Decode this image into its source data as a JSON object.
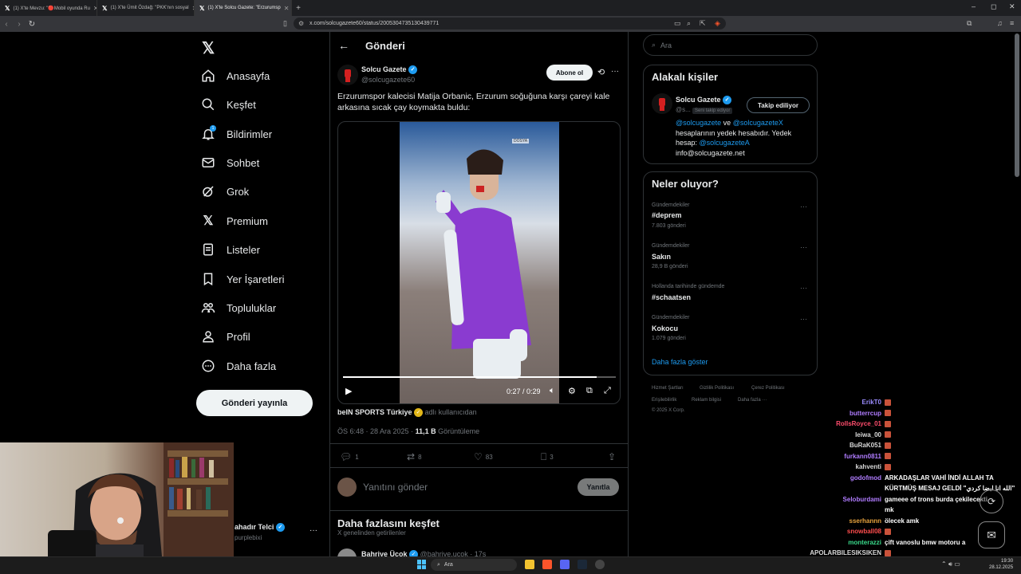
{
  "browser": {
    "tabs": [
      {
        "label": "(1) X'te Mevzu: \"🔴Mobil oyunda Ru",
        "active": false
      },
      {
        "label": "(1) X'te Ümit Özdağ: \"PKK'nın sosyal",
        "active": false
      },
      {
        "label": "(1) X'te Solcu Gazete: \"Erzurumsp",
        "active": true
      }
    ],
    "url": "x.com/solcugazete60/status/2005304735130439771"
  },
  "sidebar": {
    "items": [
      {
        "label": "Anasayfa",
        "icon": "home-icon"
      },
      {
        "label": "Keşfet",
        "icon": "search-icon"
      },
      {
        "label": "Bildirimler",
        "icon": "bell-icon"
      },
      {
        "label": "Sohbet",
        "icon": "mail-icon"
      },
      {
        "label": "Grok",
        "icon": "grok-icon"
      },
      {
        "label": "Premium",
        "icon": "x-logo-icon"
      },
      {
        "label": "Listeler",
        "icon": "list-icon"
      },
      {
        "label": "Yer İşaretleri",
        "icon": "bookmark-icon"
      },
      {
        "label": "Topluluklar",
        "icon": "people-icon"
      },
      {
        "label": "Profil",
        "icon": "profile-icon"
      },
      {
        "label": "Daha fazla",
        "icon": "more-circle-icon"
      }
    ],
    "notification_count": "1",
    "post_button": "Gönderi yayınla",
    "account_name": "ahadır Telci",
    "account_handle": "purplebixi"
  },
  "main": {
    "header_title": "Gönderi",
    "author_name": "Solcu Gazete",
    "author_handle": "@solcugazete60",
    "subscribe_label": "Abone ol",
    "post_text": "Erzurumspor kalecisi Matija Orbanic, Erzurum soğuğuna karşı çareyi kale arkasına sıcak çay koymakta buldu:",
    "video_time": "0:27 / 0:29",
    "video_progress": 0.93,
    "video_watermark": "DOSYA",
    "source_name": "beIN SPORTS Türkiye",
    "source_suffix": "adlı kullanıcıdan",
    "timestamp": "ÖS 6:48 · 28 Ara 2025 ·",
    "views_count": "11,1 B",
    "views_label": "Görüntüleme",
    "replies": "1",
    "reposts": "8",
    "likes": "83",
    "bookmarks": "3",
    "reply_placeholder": "Yanıtını gönder",
    "reply_button": "Yanıtla",
    "discover_title": "Daha fazlasını keşfet",
    "discover_subtitle": "X genelinden getirilenler",
    "next_author": "Bahriye Üçok",
    "next_handle": "@bahriye.ucok · 17s"
  },
  "right": {
    "search_placeholder": "Ara",
    "related_title": "Alakalı kişiler",
    "related_name": "Solcu Gazete",
    "related_handle": "@s...",
    "follows_you": "Seni takip ediyor",
    "following_button": "Takip ediliyor",
    "bio_mention1": "@solcugazete",
    "bio_and": " ve ",
    "bio_mention2": "@solcugazeteX",
    "bio_text1": "hesaplarının yedek hesabıdır. Yedek",
    "bio_text2": "hesap: ",
    "bio_mention3": "@solcugazeteA",
    "bio_email": "info@solcugazete.net",
    "trends_title": "Neler oluyor?",
    "trends": [
      {
        "category": "Gündemdekiler",
        "name": "#deprem",
        "count": "7.803 gönderi"
      },
      {
        "category": "Gündemdekiler",
        "name": "Sakın",
        "count": "28,9 B gönderi"
      },
      {
        "category": "Hollanda tarihinde gündemde",
        "name": "#schaatsen",
        "count": ""
      },
      {
        "category": "Gündemdekiler",
        "name": "Kokocu",
        "count": "1.079 gönderi"
      }
    ],
    "show_more": "Daha fazla göster",
    "footer": [
      "Hizmet Şartları",
      "Gizlilik Politikası",
      "Çerez Politikası",
      "Erişilebilirlik",
      "Reklam bilgisi",
      "Daha fazla ···"
    ],
    "copyright": "© 2025 X Corp."
  },
  "chat": [
    {
      "user": "ErikT0",
      "color": "#9b8cff",
      "msg": ""
    },
    {
      "user": "butterrcup",
      "color": "#b07cff",
      "msg": ""
    },
    {
      "user": "RollsRoyce_01",
      "color": "#ff4d6d",
      "msg": ""
    },
    {
      "user": "leiwa_00",
      "color": "#d9d9d9",
      "msg": ""
    },
    {
      "user": "BuRaK051",
      "color": "#d9d9d9",
      "msg": ""
    },
    {
      "user": "furkann0811",
      "color": "#b07cff",
      "msg": ""
    },
    {
      "user": "kahventi",
      "color": "#d9d9d9",
      "msg": ""
    },
    {
      "user": "godofmod",
      "color": "#b07cff",
      "msg": "ARKADAŞLAR VAHİ İNDİ ALLAH TA"
    },
    {
      "user": "",
      "color": "#b07cff",
      "msg": "KÜRTMÜŞ MESAJ GELDİ \"الله انا ايضا كردي\""
    },
    {
      "user": "Seloburdami",
      "color": "#b07cff",
      "msg": "gameee of trons burda çekilecekti"
    },
    {
      "user": "",
      "color": "#b07cff",
      "msg": "mk"
    },
    {
      "user": "sserhannn",
      "color": "#e8a33d",
      "msg": "ölecek amk"
    },
    {
      "user": "snowball08",
      "color": "#ff4d4d",
      "msg": ""
    },
    {
      "user": "monterazzi",
      "color": "#39d98a",
      "msg": "çift vanoslu bmw motoru a"
    },
    {
      "user": "APOLARBILESIKSIKEN",
      "color": "#d9d9d9",
      "msg": ""
    }
  ],
  "taskbar": {
    "search_label": "Ara",
    "time": "19:30",
    "date": "28.12.2025"
  }
}
